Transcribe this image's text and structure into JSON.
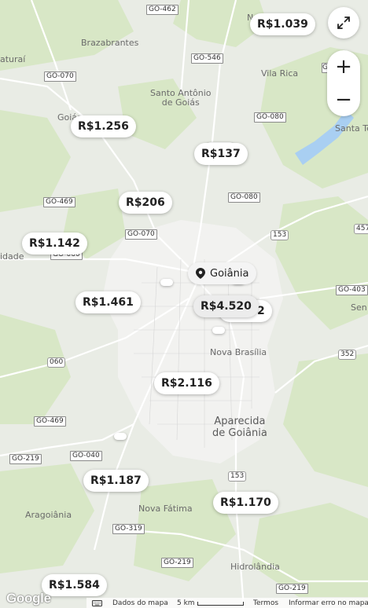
{
  "map": {
    "places": {
      "brazabrantes": "Brazabrantes",
      "itaurai": "aturaí",
      "santo_antonio": "Santo Antônio\nde Goiás",
      "vila_rica": "Vila Rica",
      "santa_te": "Santa Te",
      "goias": "Goiás",
      "idade": "idade",
      "nova_brasilia": "Nova Brasília",
      "aparecida": "Aparecida\nde Goiânia",
      "nova_fatima": "Nova Fátima",
      "aragoiania": "Aragoiânia",
      "hidrolandia": "Hidrolândia",
      "sen": "Sen",
      "n_top": "N"
    },
    "shields": [
      "GO-462",
      "GO-546",
      "GO-070",
      "GO-080",
      "GO-469",
      "GO-080",
      "GO-070",
      "153",
      "457",
      "GO-060",
      "GO-403",
      "352",
      "060",
      "GO-469",
      "GO-219",
      "GO-040",
      "153",
      "GO-319",
      "GO-219",
      "GO-219",
      "GO-070"
    ],
    "city": "Goiânia",
    "prices": {
      "p1039": "R$1.039",
      "p1256": "R$1.256",
      "p137": "R$137",
      "p206": "R$206",
      "p1142": "R$1.142",
      "p1461": "R$1.461",
      "p4520": "R$4.520",
      "p962": "R$962",
      "p2116": "R$2.116",
      "p1187": "R$1.187",
      "p1170": "R$1.170",
      "p1584": "R$1.584"
    }
  },
  "controls": {
    "zoom_in": "+",
    "zoom_out": "−"
  },
  "attribution": {
    "logo": "Google",
    "keyboard": "Dados do mapa",
    "scale": "5 km",
    "terms": "Termos",
    "report": "Informar erro no mapa"
  },
  "colors": {
    "green": "#d9e8c8",
    "land": "#eceeea",
    "urban": "#f3f3f1",
    "water": "#a9cff2"
  }
}
